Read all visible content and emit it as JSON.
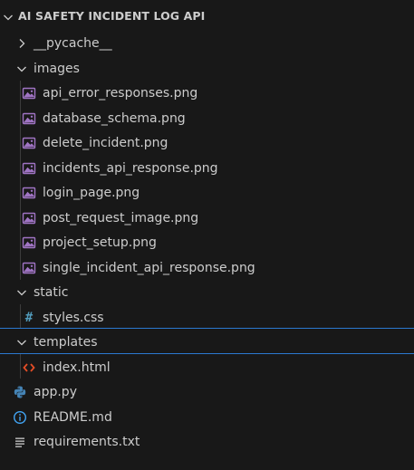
{
  "explorer": {
    "root": {
      "label": "AI SAFETY INCIDENT LOG API",
      "expanded": true
    },
    "folders": {
      "pycache": {
        "label": "__pycache__",
        "expanded": false
      },
      "images": {
        "label": "images",
        "expanded": true
      },
      "static": {
        "label": "static",
        "expanded": true
      },
      "templates": {
        "label": "templates",
        "expanded": true
      }
    },
    "images_files": [
      {
        "label": "api_error_responses.png",
        "icon": "image-file-icon"
      },
      {
        "label": "database_schema.png",
        "icon": "image-file-icon"
      },
      {
        "label": "delete_incident.png",
        "icon": "image-file-icon"
      },
      {
        "label": "incidents_api_response.png",
        "icon": "image-file-icon"
      },
      {
        "label": "login_page.png",
        "icon": "image-file-icon"
      },
      {
        "label": "post_request_image.png",
        "icon": "image-file-icon"
      },
      {
        "label": "project_setup.png",
        "icon": "image-file-icon"
      },
      {
        "label": "single_incident_api_response.png",
        "icon": "image-file-icon"
      }
    ],
    "static_files": [
      {
        "label": "styles.css",
        "icon": "css-hash-icon"
      }
    ],
    "templates_files": [
      {
        "label": "index.html",
        "icon": "html-code-icon"
      }
    ],
    "root_files": [
      {
        "label": "app.py",
        "icon": "python-icon"
      },
      {
        "label": "README.md",
        "icon": "info-icon"
      },
      {
        "label": "requirements.txt",
        "icon": "text-lines-icon"
      }
    ],
    "colors": {
      "background": "#181818",
      "text": "#cccccc",
      "image_icon": "#a074c4",
      "css_icon": "#519aba",
      "html_icon": "#e44d26",
      "python_icon": "#4584b6",
      "info_icon": "#42a5f5",
      "focus_border": "#2b79d0",
      "indent_guide": "#3b3b3b"
    }
  }
}
